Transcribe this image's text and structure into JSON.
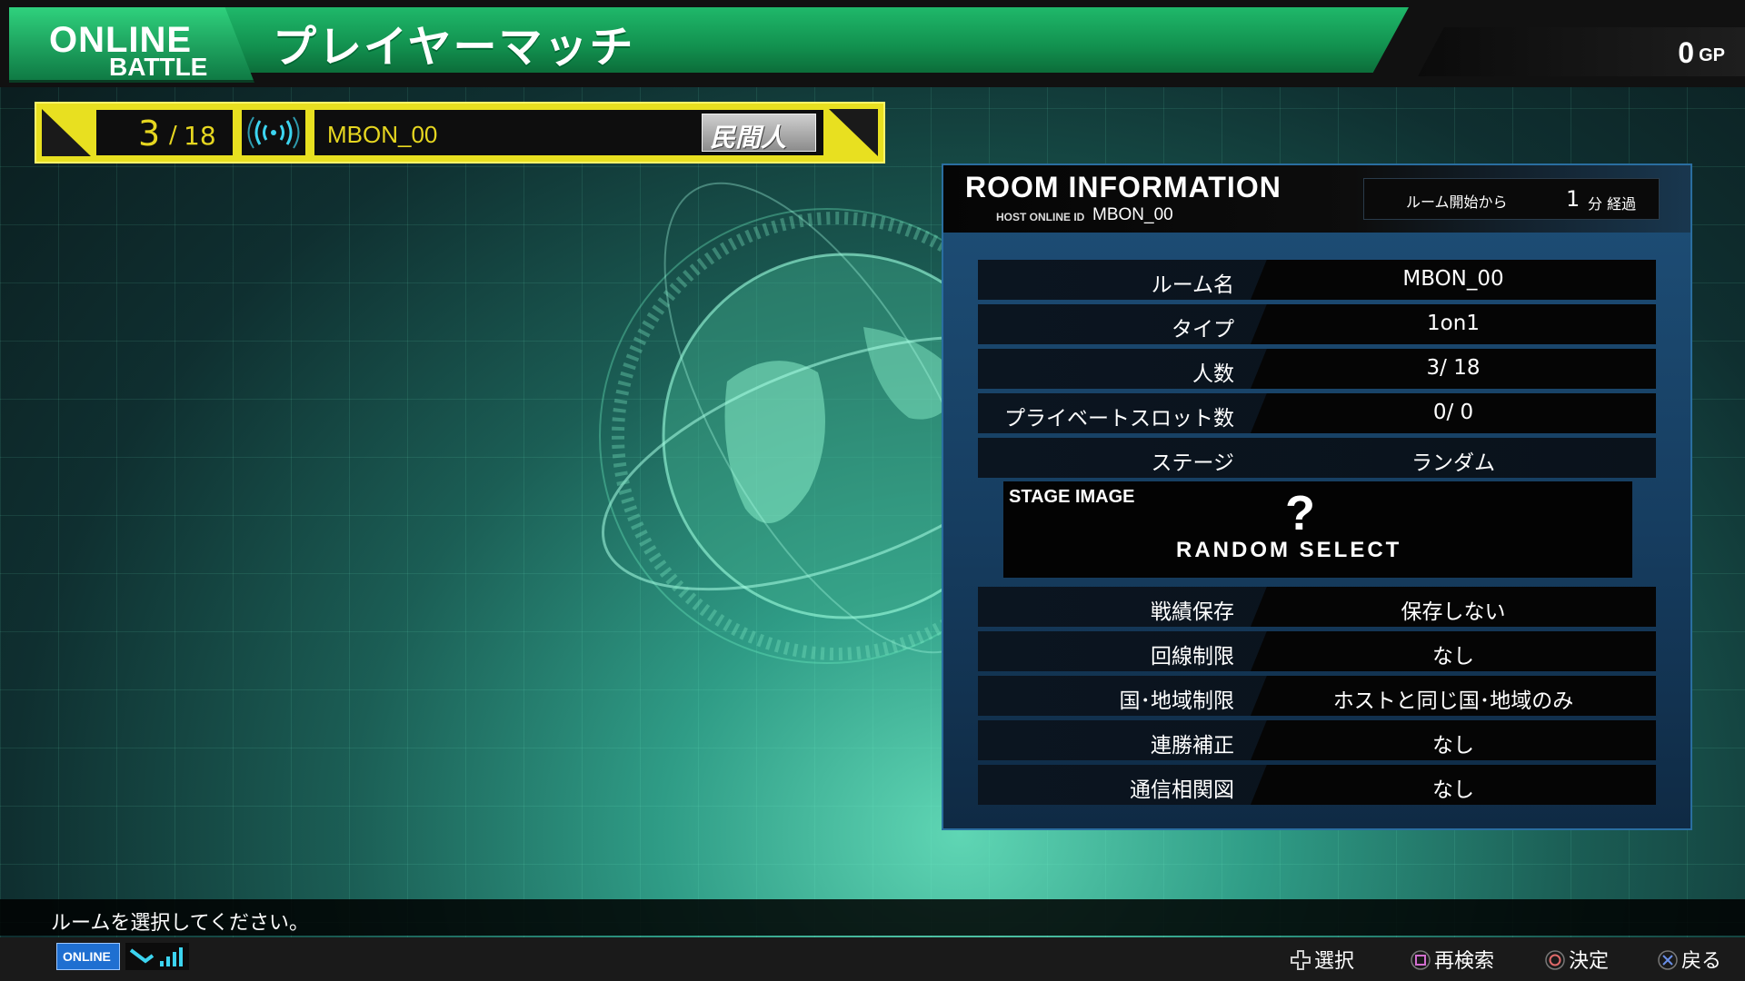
{
  "header": {
    "badge_line1": "ONLINE",
    "badge_line2": "BATTLE",
    "title": "プレイヤーマッチ",
    "gp_value": "0",
    "gp_unit": "GP"
  },
  "room_bar": {
    "count_current": "3",
    "count_separator": "/",
    "count_max": "18",
    "room_name": "MBON_00",
    "rank_label": "民間人"
  },
  "room_info": {
    "title": "ROOM INFORMATION",
    "host_label": "HOST ONLINE ID",
    "host_id": "MBON_00",
    "elapsed_label": "ルーム開始から",
    "elapsed_value": "1",
    "elapsed_unit": "分 経過",
    "rows": [
      {
        "label": "ルーム名",
        "value": "MBON_00"
      },
      {
        "label": "タイプ",
        "value": "1on1"
      },
      {
        "label": "人数",
        "value": "3/ 18"
      },
      {
        "label": "プライベートスロット数",
        "value": "0/ 0"
      },
      {
        "label": "ステージ",
        "value": "ランダム"
      },
      {
        "label": "戦績保存",
        "value": "保存しない"
      },
      {
        "label": "回線制限",
        "value": "なし"
      },
      {
        "label": "国･地域制限",
        "value": "ホストと同じ国･地域のみ"
      },
      {
        "label": "連勝補正",
        "value": "なし"
      },
      {
        "label": "通信相関図",
        "value": "なし"
      }
    ],
    "stage_image_label": "STAGE IMAGE",
    "stage_image_symbol": "?",
    "stage_image_text": "RANDOM SELECT"
  },
  "bottom": {
    "message": "ルームを選択してください。",
    "online_badge": "ONLINE",
    "controls": [
      {
        "icon": "dpad-icon",
        "label": "選択"
      },
      {
        "icon": "square-button-icon",
        "label": "再検索"
      },
      {
        "icon": "circle-button-icon",
        "label": "決定"
      },
      {
        "icon": "cross-button-icon",
        "label": "戻る"
      }
    ]
  },
  "colors": {
    "header_green": "#12914f",
    "room_bar_yellow": "#e8e020",
    "panel_blue": "#1e4f78",
    "square_button": "#d36fd0",
    "circle_button": "#e06a6a",
    "cross_button": "#6a8fe8"
  }
}
